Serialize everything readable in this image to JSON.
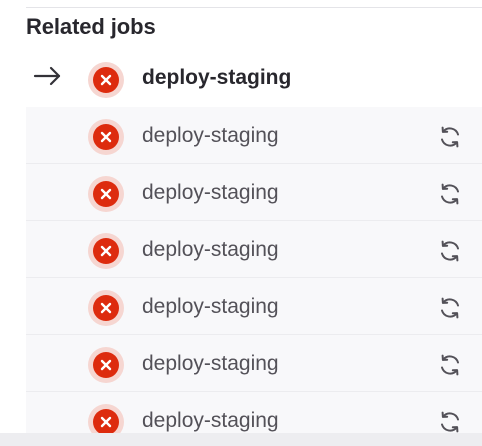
{
  "section": {
    "title": "Related jobs"
  },
  "jobs": [
    {
      "name": "deploy-staging",
      "status": "failed",
      "current": true
    },
    {
      "name": "deploy-staging",
      "status": "failed",
      "current": false
    },
    {
      "name": "deploy-staging",
      "status": "failed",
      "current": false
    },
    {
      "name": "deploy-staging",
      "status": "failed",
      "current": false
    },
    {
      "name": "deploy-staging",
      "status": "failed",
      "current": false
    },
    {
      "name": "deploy-staging",
      "status": "failed",
      "current": false
    },
    {
      "name": "deploy-staging",
      "status": "failed",
      "current": false
    }
  ],
  "icons": {
    "current_marker": "arrow-right-icon",
    "status": "status-failed-icon",
    "retry": "retry-icon"
  },
  "colors": {
    "failed": "#dd2b0e",
    "failed_halo": "#f6d6d1"
  }
}
